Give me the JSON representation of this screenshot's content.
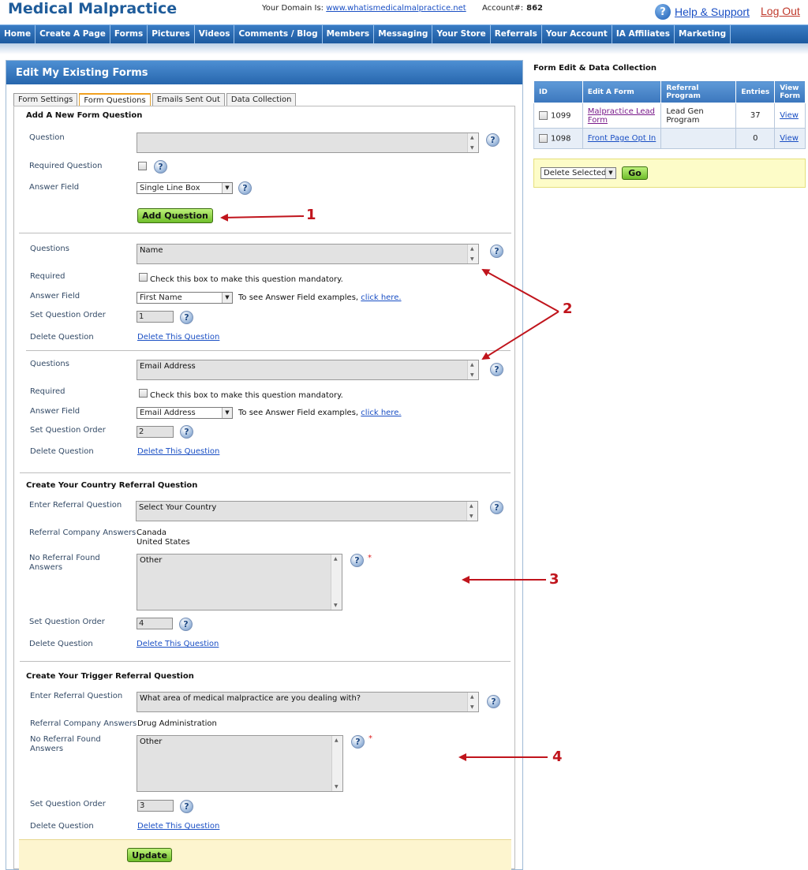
{
  "header": {
    "site_title": "Medical Malpractice",
    "domain_label": "Your Domain Is:",
    "domain_url": "www.whatismedicalmalpractice.net",
    "account_label": "Account#:",
    "account_number": "862",
    "help_label": "Help & Support",
    "logout_label": "Log Out"
  },
  "nav": {
    "items": [
      "Home",
      "Create A Page",
      "Forms",
      "Pictures",
      "Videos",
      "Comments / Blog",
      "Members",
      "Messaging",
      "Your Store",
      "Referrals",
      "Your Account",
      "IA Affiliates",
      "Marketing"
    ]
  },
  "panel": {
    "title": "Edit My Existing Forms",
    "tabs": [
      "Form Settings",
      "Form Questions",
      "Emails Sent Out",
      "Data Collection"
    ],
    "active_tab": "Form Questions"
  },
  "add_question": {
    "section_title": "Add A New Form Question",
    "question_label": "Question",
    "question_value": "",
    "required_label": "Required Question",
    "answer_field_label": "Answer Field",
    "answer_field_value": "Single Line Box",
    "button_label": "Add Question"
  },
  "questions": [
    {
      "questions_label": "Questions",
      "question_value": "Name",
      "required_label": "Required",
      "required_text": "Check this box to make this question mandatory.",
      "answer_field_label": "Answer Field",
      "answer_field_value": "First Name",
      "examples_text": "To see Answer Field examples,",
      "examples_link": "click here.",
      "order_label": "Set Question Order",
      "order_value": "1",
      "delete_label": "Delete Question",
      "delete_link": "Delete This Question"
    },
    {
      "questions_label": "Questions",
      "question_value": "Email Address",
      "required_label": "Required",
      "required_text": "Check this box to make this question mandatory.",
      "answer_field_label": "Answer Field",
      "answer_field_value": "Email Address",
      "examples_text": "To see Answer Field examples,",
      "examples_link": "click here.",
      "order_label": "Set Question Order",
      "order_value": "2",
      "delete_label": "Delete Question",
      "delete_link": "Delete This Question"
    }
  ],
  "country_referral": {
    "section_title": "Create Your Country Referral Question",
    "enter_label": "Enter Referral Question",
    "question_value": "Select Your Country",
    "company_answers_label": "Referral Company Answers",
    "company_answers": [
      "Canada",
      "United States"
    ],
    "no_referral_label": "No Referral Found Answers",
    "no_referral_value": "Other",
    "required_star": "*",
    "order_label": "Set Question Order",
    "order_value": "4",
    "delete_label": "Delete Question",
    "delete_link": "Delete This Question"
  },
  "trigger_referral": {
    "section_title": "Create Your Trigger Referral Question",
    "enter_label": "Enter Referral Question",
    "question_value": "What area of medical malpractice are you dealing with?",
    "company_answers_label": "Referral Company Answers",
    "company_answers": [
      "Drug Administration"
    ],
    "no_referral_label": "No Referral Found Answers",
    "no_referral_value": "Other",
    "required_star": "*",
    "order_label": "Set Question Order",
    "order_value": "3",
    "delete_label": "Delete Question",
    "delete_link": "Delete This Question"
  },
  "update_button_label": "Update",
  "help_glyph": "?",
  "annotations": [
    "1",
    "2",
    "3",
    "4"
  ],
  "right": {
    "title": "Form Edit & Data Collection",
    "columns": [
      "ID",
      "Edit A Form",
      "Referral Program",
      "Entries",
      "View Form"
    ],
    "rows": [
      {
        "id": "1099",
        "form": "Malpractice Lead Form",
        "program": "Lead Gen Program",
        "entries": "37",
        "view": "View"
      },
      {
        "id": "1098",
        "form": "Front Page Opt In",
        "program": "",
        "entries": "0",
        "view": "View"
      }
    ],
    "bulk_action": "Delete Selected",
    "go_label": "Go"
  },
  "colors": {
    "brand_blue": "#1f5c9a",
    "nav_blue": "#2766ad",
    "annotation_red": "#c0141c",
    "button_green": "#8fd43a"
  }
}
